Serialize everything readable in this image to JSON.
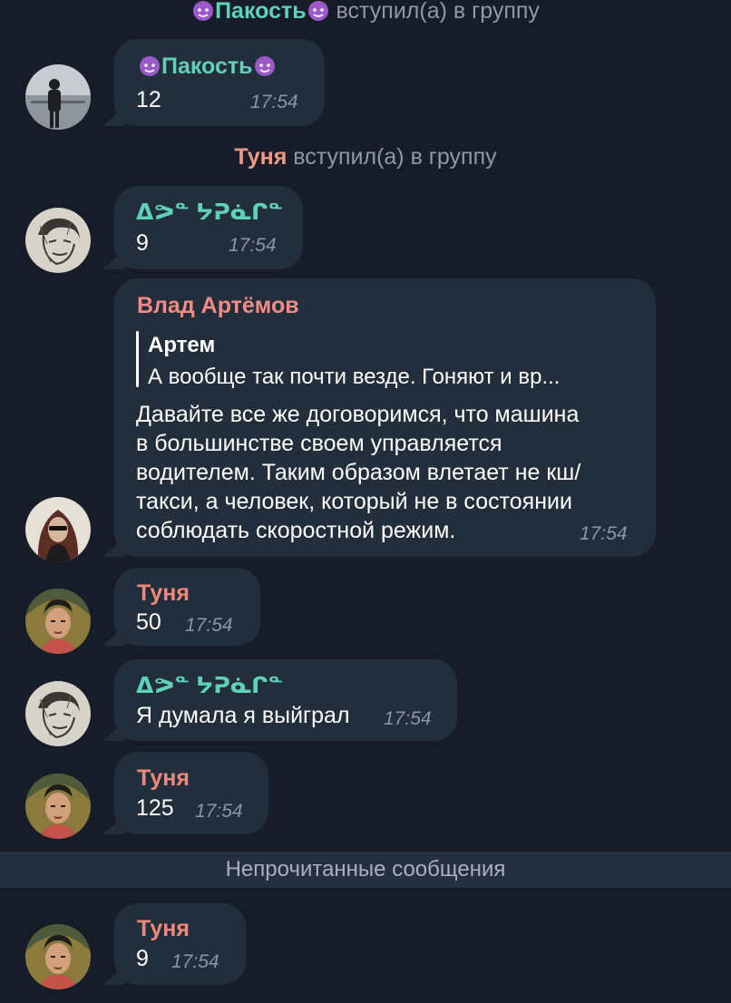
{
  "events": [
    {
      "name": "Пакость",
      "action": "вступил(а) в группу"
    },
    {
      "name": "Туня",
      "action": "вступил(а) в группу"
    }
  ],
  "emoji": {
    "devil": "devil-emoji"
  },
  "messages": [
    {
      "sender": "Пакость",
      "text": "12",
      "time": "17:54"
    },
    {
      "sender": "ᐃᕗᓐ ᔭᕈᓈᒋᓐ",
      "text": "9",
      "time": "17:54"
    },
    {
      "sender": "Влад Артёмов",
      "reply": {
        "name": "Артем",
        "text": "А вообще так почти везде. Гоняют и вр..."
      },
      "lines": [
        "Давайте все же договоримся, что машина",
        "в большинстве своем управляется",
        "водителем. Таким образом влетает не кш/",
        "такси, а человек, который не в состоянии",
        "соблюдать скоростной режим."
      ],
      "time": "17:54"
    },
    {
      "sender": "Туня",
      "text": "50",
      "time": "17:54"
    },
    {
      "sender": "ᐃᕗᓐ ᔭᕈᓈᒋᓐ",
      "text": "Я думала я выйграл",
      "time": "17:54"
    },
    {
      "sender": "Туня",
      "text": "125",
      "time": "17:54"
    },
    {
      "sender": "Туня",
      "text": "9",
      "time": "17:54"
    }
  ],
  "unread_label": "Непрочитанные сообщения",
  "colors": {
    "background": "#161d28",
    "bubble": "#222e3c",
    "name_green": "#5fd1bb",
    "name_pink": "#f38b83"
  }
}
